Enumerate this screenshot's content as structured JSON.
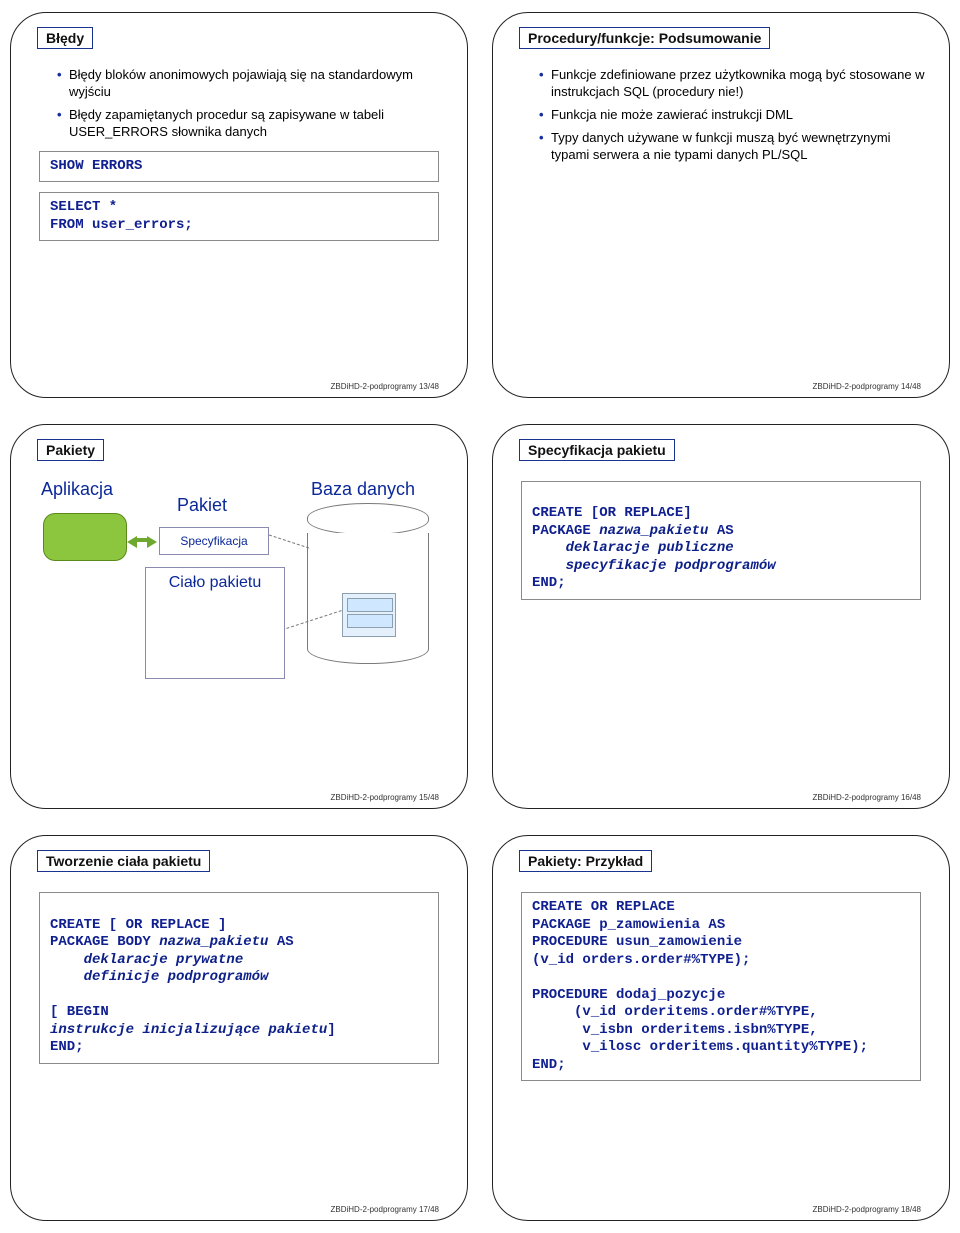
{
  "slides": {
    "s1": {
      "title": "Błędy",
      "bullets": [
        "Błędy bloków anonimowych pojawiają się na standardowym wyjściu",
        "Błędy zapamiętanych procedur są zapisywane w tabeli USER_ERRORS słownika danych"
      ],
      "code1": "SHOW ERRORS",
      "code2": "SELECT *\nFROM user_errors;",
      "footer": "ZBDiHD-2-podprogramy 13/48"
    },
    "s2": {
      "title": "Procedury/funkcje: Podsumowanie",
      "bullets": [
        "Funkcje zdefiniowane przez użytkownika mogą być stosowane w instrukcjach SQL (procedury nie!)",
        "Funkcja nie może zawierać instrukcji DML",
        "Typy danych używane w funkcji muszą być wewnętrzynymi typami serwera a nie typami danych PL/SQL"
      ],
      "footer": "ZBDiHD-2-podprogramy 14/48"
    },
    "s3": {
      "title": "Pakiety",
      "diag": {
        "app": "Aplikacja",
        "db": "Baza danych",
        "pakiet": "Pakiet",
        "spec": "Specyfikacja",
        "body": "Ciało pakietu"
      },
      "footer": "ZBDiHD-2-podprogramy 15/48"
    },
    "s4": {
      "title": "Specyfikacja pakietu",
      "code_lines": {
        "l1": "CREATE [OR REPLACE]",
        "l2": "PACKAGE ",
        "l2it": "nazwa_pakietu",
        "l2b": " AS",
        "l3it": "    deklaracje publiczne",
        "l4it": "    specyfikacje podprogramów",
        "l5": "END;"
      },
      "footer": "ZBDiHD-2-podprogramy 16/48"
    },
    "s5": {
      "title": "Tworzenie ciała pakietu",
      "code_lines": {
        "l1": "CREATE [ OR REPLACE ]",
        "l2": "PACKAGE BODY ",
        "l2it": "nazwa_pakietu",
        "l2b": " AS",
        "l3it": "    deklaracje prywatne",
        "l4it": "    definicje podprogramów",
        "blank": " ",
        "l5a": "[ BEGIN",
        "l5it": "instrukcje inicjalizujące pakietu",
        "l5b": "]",
        "l6": "END;"
      },
      "footer": "ZBDiHD-2-podprogramy 17/48"
    },
    "s6": {
      "title": "Pakiety: Przykład",
      "code": "CREATE OR REPLACE\nPACKAGE p_zamowienia AS\nPROCEDURE usun_zamowienie\n(v_id orders.order#%TYPE);\n\nPROCEDURE dodaj_pozycje\n     (v_id orderitems.order#%TYPE,\n      v_isbn orderitems.isbn%TYPE,\n      v_ilosc orderitems.quantity%TYPE);\nEND;",
      "footer": "ZBDiHD-2-podprogramy 18/48"
    }
  }
}
